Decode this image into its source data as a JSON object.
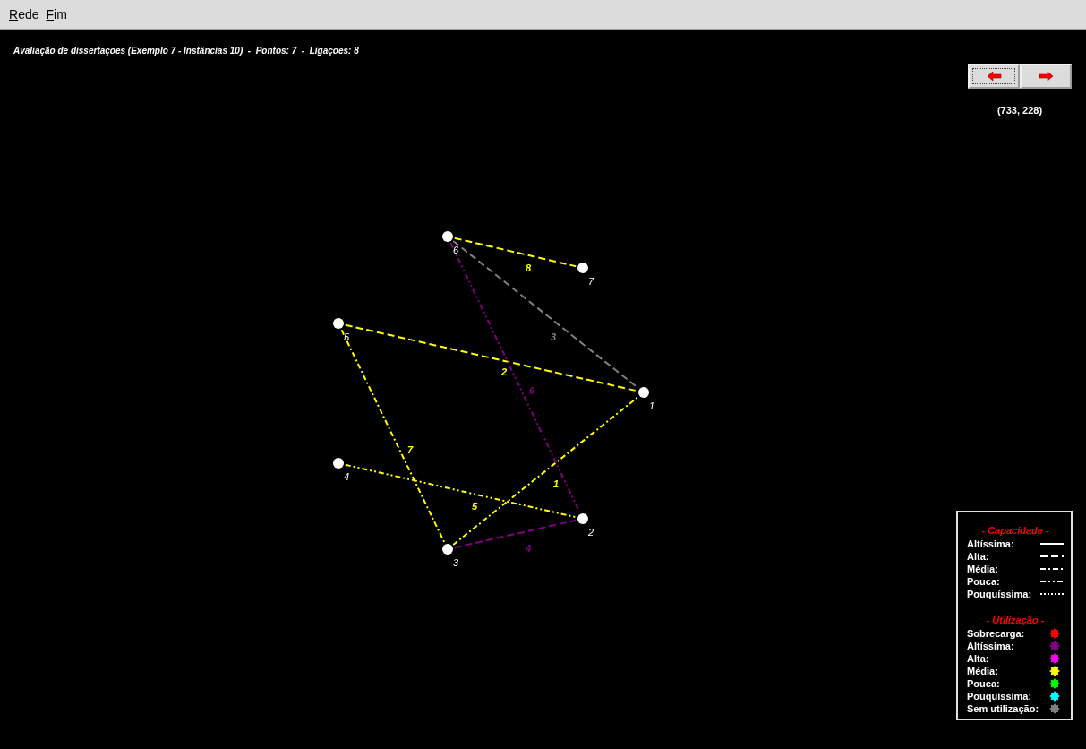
{
  "menu": [
    {
      "label": "Rede"
    },
    {
      "label": "Fim"
    }
  ],
  "title": "Avaliação de dissertações (Exemplo 7 - Instâncias 10)  -  Pontos: 7  -  Ligações: 8",
  "nav_buttons": [
    {
      "kind": "prev",
      "focused": true
    },
    {
      "kind": "next",
      "focused": false
    }
  ],
  "coordinates": "(733, 228)",
  "graph": {
    "nodes": [
      {
        "label": "1"
      },
      {
        "label": "2"
      },
      {
        "label": "3"
      },
      {
        "label": "4"
      },
      {
        "label": "5"
      },
      {
        "label": "6"
      },
      {
        "label": "7"
      }
    ],
    "edges": [
      {
        "label": "1",
        "kind": "media",
        "color": "#ffff00"
      },
      {
        "label": "2",
        "kind": "alta",
        "color": "#ffff00"
      },
      {
        "label": "3",
        "kind": "alta",
        "color": "#808080"
      },
      {
        "label": "4",
        "kind": "alta",
        "color": "#800080"
      },
      {
        "label": "5",
        "kind": "pouca",
        "color": "#ffff00"
      },
      {
        "label": "6",
        "kind": "pouca",
        "color": "#800080"
      },
      {
        "label": "7",
        "kind": "media",
        "color": "#ffff00"
      },
      {
        "label": "8",
        "kind": "alta",
        "color": "#ffff00"
      }
    ]
  },
  "legend": {
    "capacity_title": "- Capacidade -",
    "capacity": [
      {
        "label": "Altíssima:",
        "kind": "altissima"
      },
      {
        "label": "Alta:",
        "kind": "alta"
      },
      {
        "label": "Média:",
        "kind": "media"
      },
      {
        "label": "Pouca:",
        "kind": "pouca"
      },
      {
        "label": "Pouquíssima:",
        "kind": "pouquissima"
      }
    ],
    "utilization_title": "- Utilização -",
    "utilization": [
      {
        "label": "Sobrecarga:",
        "color": "#ff0000"
      },
      {
        "label": "Altíssima:",
        "color": "#800080"
      },
      {
        "label": "Alta:",
        "color": "#ff00ff"
      },
      {
        "label": "Média:",
        "color": "#ffff00"
      },
      {
        "label": "Pouca:",
        "color": "#00ff00"
      },
      {
        "label": "Pouquíssima:",
        "color": "#00ffff"
      },
      {
        "label": "Sem utilização:",
        "color": "#808080"
      }
    ]
  }
}
